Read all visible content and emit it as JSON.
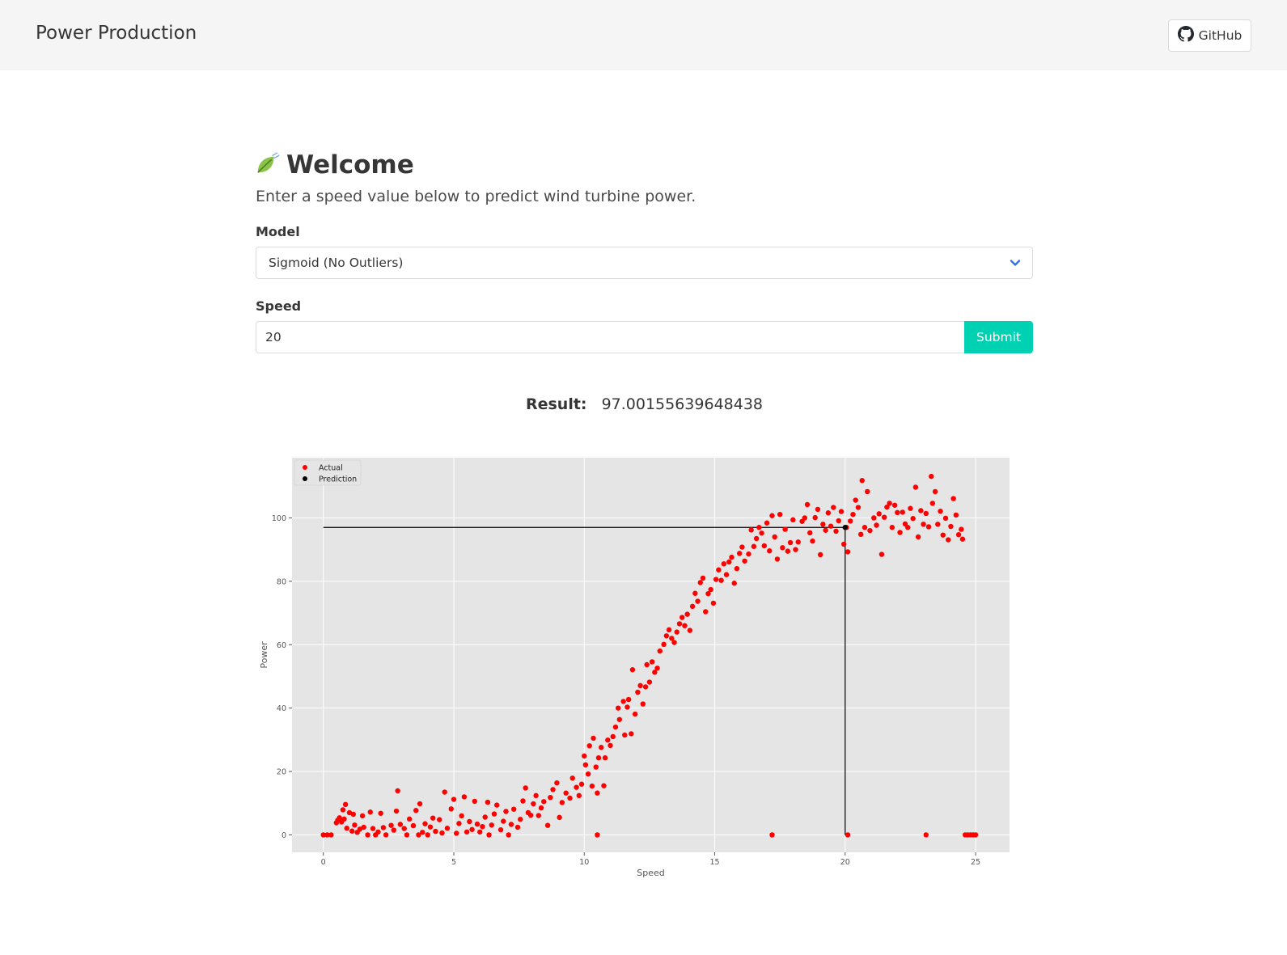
{
  "navbar": {
    "brand": "Power Production",
    "github_label": "GitHub"
  },
  "hero": {
    "title": "Welcome",
    "subtitle": "Enter a speed value below to predict wind turbine power."
  },
  "form": {
    "model_label": "Model",
    "model_value": "Sigmoid (No Outliers)",
    "speed_label": "Speed",
    "speed_value": "20",
    "submit_label": "Submit"
  },
  "result": {
    "label": "Result:",
    "value": "97.00155639648438"
  },
  "colors": {
    "accent": "#00d1b2",
    "actual": "#ff0000",
    "prediction": "#000000",
    "chevron": "#3273dc"
  },
  "chart_data": {
    "type": "scatter",
    "title": "",
    "xlabel": "Speed",
    "ylabel": "Power",
    "xlim": [
      -1.2,
      26.3
    ],
    "ylim": [
      -5.5,
      119
    ],
    "xticks": [
      0,
      5,
      10,
      15,
      20,
      25
    ],
    "yticks": [
      0,
      20,
      40,
      60,
      80,
      100
    ],
    "grid": true,
    "legend": "top-left",
    "series": [
      {
        "name": "Actual",
        "color": "#ff0000",
        "points": [
          [
            0,
            0
          ],
          [
            0.15,
            0
          ],
          [
            0.3,
            0
          ],
          [
            0.5,
            3.8
          ],
          [
            0.55,
            4.6
          ],
          [
            0.62,
            5.4
          ],
          [
            0.7,
            4.1
          ],
          [
            0.75,
            7.9
          ],
          [
            0.8,
            5.0
          ],
          [
            0.85,
            9.6
          ],
          [
            0.9,
            2.1
          ],
          [
            1.0,
            7.0
          ],
          [
            1.1,
            1.2
          ],
          [
            1.15,
            6.5
          ],
          [
            1.2,
            3.1
          ],
          [
            1.3,
            0.8
          ],
          [
            1.4,
            1.8
          ],
          [
            1.5,
            6.0
          ],
          [
            1.55,
            2.4
          ],
          [
            1.7,
            0
          ],
          [
            1.8,
            7.2
          ],
          [
            1.9,
            2.0
          ],
          [
            2.0,
            0
          ],
          [
            2.1,
            0.9
          ],
          [
            2.2,
            6.8
          ],
          [
            2.3,
            2.3
          ],
          [
            2.4,
            0
          ],
          [
            2.6,
            3.0
          ],
          [
            2.7,
            1.5
          ],
          [
            2.8,
            7.5
          ],
          [
            2.85,
            13.9
          ],
          [
            2.95,
            3.3
          ],
          [
            3.1,
            2.0
          ],
          [
            3.2,
            0
          ],
          [
            3.3,
            5.0
          ],
          [
            3.45,
            2.9
          ],
          [
            3.55,
            7.7
          ],
          [
            3.65,
            0
          ],
          [
            3.7,
            9.8
          ],
          [
            3.8,
            0.8
          ],
          [
            3.9,
            3.5
          ],
          [
            4.0,
            0
          ],
          [
            4.1,
            2.5
          ],
          [
            4.2,
            5.3
          ],
          [
            4.3,
            1.1
          ],
          [
            4.45,
            4.8
          ],
          [
            4.55,
            0.6
          ],
          [
            4.65,
            13.5
          ],
          [
            4.75,
            2.1
          ],
          [
            4.9,
            8.2
          ],
          [
            5.0,
            11.2
          ],
          [
            5.1,
            0.5
          ],
          [
            5.2,
            3.6
          ],
          [
            5.3,
            6.0
          ],
          [
            5.4,
            12.0
          ],
          [
            5.5,
            0.9
          ],
          [
            5.6,
            4.2
          ],
          [
            5.7,
            1.7
          ],
          [
            5.8,
            10.6
          ],
          [
            5.9,
            3.4
          ],
          [
            6.0,
            0.9
          ],
          [
            6.1,
            2.6
          ],
          [
            6.2,
            5.6
          ],
          [
            6.3,
            10.3
          ],
          [
            6.35,
            0
          ],
          [
            6.45,
            3.1
          ],
          [
            6.55,
            6.6
          ],
          [
            6.65,
            9.4
          ],
          [
            6.8,
            1.6
          ],
          [
            6.9,
            4.3
          ],
          [
            7.0,
            7.4
          ],
          [
            7.1,
            0
          ],
          [
            7.2,
            3.3
          ],
          [
            7.3,
            8.1
          ],
          [
            7.45,
            2.4
          ],
          [
            7.55,
            4.9
          ],
          [
            7.65,
            10.7
          ],
          [
            7.75,
            14.8
          ],
          [
            7.85,
            7.0
          ],
          [
            7.95,
            6.2
          ],
          [
            8.05,
            9.8
          ],
          [
            8.15,
            12.4
          ],
          [
            8.25,
            6.1
          ],
          [
            8.35,
            8.5
          ],
          [
            8.45,
            10.5
          ],
          [
            8.6,
            3.0
          ],
          [
            8.7,
            11.8
          ],
          [
            8.8,
            14.3
          ],
          [
            8.95,
            16.4
          ],
          [
            9.05,
            5.5
          ],
          [
            9.15,
            10.2
          ],
          [
            9.3,
            13.2
          ],
          [
            9.45,
            11.6
          ],
          [
            9.55,
            17.9
          ],
          [
            9.7,
            15.0
          ],
          [
            9.8,
            12.4
          ],
          [
            9.9,
            16.0
          ],
          [
            10.0,
            24.9
          ],
          [
            10.05,
            22.1
          ],
          [
            10.15,
            19.2
          ],
          [
            10.2,
            28.1
          ],
          [
            10.3,
            15.4
          ],
          [
            10.35,
            30.5
          ],
          [
            10.45,
            21.4
          ],
          [
            10.5,
            13.2
          ],
          [
            10.55,
            24.3
          ],
          [
            10.5,
            0
          ],
          [
            10.65,
            27.6
          ],
          [
            10.75,
            15.5
          ],
          [
            10.8,
            24.3
          ],
          [
            10.9,
            29.9
          ],
          [
            11.0,
            28.2
          ],
          [
            11.1,
            31.0
          ],
          [
            11.2,
            34.0
          ],
          [
            11.3,
            40.0
          ],
          [
            11.35,
            36.4
          ],
          [
            11.5,
            42.1
          ],
          [
            11.55,
            31.5
          ],
          [
            11.65,
            40.3
          ],
          [
            11.7,
            42.7
          ],
          [
            11.8,
            31.9
          ],
          [
            11.85,
            52.1
          ],
          [
            11.95,
            38.1
          ],
          [
            12.05,
            45.0
          ],
          [
            12.15,
            47.1
          ],
          [
            12.25,
            41.3
          ],
          [
            12.35,
            46.7
          ],
          [
            12.4,
            53.7
          ],
          [
            12.5,
            48.2
          ],
          [
            12.6,
            54.6
          ],
          [
            12.7,
            51.3
          ],
          [
            12.8,
            52.6
          ],
          [
            12.9,
            58.0
          ],
          [
            13.05,
            60.1
          ],
          [
            13.15,
            62.8
          ],
          [
            13.25,
            64.7
          ],
          [
            13.35,
            62.0
          ],
          [
            13.45,
            60.7
          ],
          [
            13.55,
            64.0
          ],
          [
            13.65,
            66.6
          ],
          [
            13.75,
            68.6
          ],
          [
            13.85,
            66.0
          ],
          [
            13.95,
            69.6
          ],
          [
            14.05,
            64.5
          ],
          [
            14.15,
            72.1
          ],
          [
            14.25,
            76.2
          ],
          [
            14.35,
            73.7
          ],
          [
            14.45,
            79.6
          ],
          [
            14.55,
            81.0
          ],
          [
            14.65,
            70.4
          ],
          [
            14.75,
            76.1
          ],
          [
            14.85,
            77.4
          ],
          [
            14.95,
            73.1
          ],
          [
            15.05,
            80.6
          ],
          [
            15.15,
            83.6
          ],
          [
            15.25,
            80.3
          ],
          [
            15.35,
            85.5
          ],
          [
            15.45,
            82.1
          ],
          [
            15.55,
            86.1
          ],
          [
            15.65,
            87.6
          ],
          [
            15.75,
            79.4
          ],
          [
            15.85,
            84.0
          ],
          [
            15.95,
            88.8
          ],
          [
            16.05,
            90.8
          ],
          [
            16.15,
            86.4
          ],
          [
            16.3,
            88.6
          ],
          [
            16.4,
            96.2
          ],
          [
            16.5,
            91.0
          ],
          [
            16.6,
            93.5
          ],
          [
            16.7,
            97.0
          ],
          [
            16.8,
            95.2
          ],
          [
            16.9,
            91.2
          ],
          [
            17.0,
            98.4
          ],
          [
            17.1,
            89.6
          ],
          [
            17.2,
            100.7
          ],
          [
            17.3,
            94.0
          ],
          [
            17.4,
            87.0
          ],
          [
            17.5,
            101.1
          ],
          [
            17.6,
            90.6
          ],
          [
            17.7,
            96.4
          ],
          [
            17.8,
            89.5
          ],
          [
            17.9,
            92.2
          ],
          [
            18.0,
            99.4
          ],
          [
            18.1,
            90.0
          ],
          [
            18.2,
            92.4
          ],
          [
            18.35,
            98.9
          ],
          [
            18.45,
            100.0
          ],
          [
            18.55,
            104.2
          ],
          [
            18.65,
            95.3
          ],
          [
            18.75,
            92.7
          ],
          [
            18.85,
            100.1
          ],
          [
            18.95,
            102.7
          ],
          [
            19.05,
            88.4
          ],
          [
            19.15,
            98.0
          ],
          [
            19.25,
            96.1
          ],
          [
            19.35,
            101.6
          ],
          [
            19.45,
            97.4
          ],
          [
            19.55,
            103.3
          ],
          [
            19.65,
            95.8
          ],
          [
            19.75,
            99.1
          ],
          [
            19.85,
            102.0
          ],
          [
            19.95,
            91.7
          ],
          [
            20.05,
            97.0
          ],
          [
            20.1,
            89.3
          ],
          [
            20.2,
            99.0
          ],
          [
            20.3,
            101.1
          ],
          [
            20.4,
            105.6
          ],
          [
            20.5,
            103.3
          ],
          [
            20.6,
            94.8
          ],
          [
            20.65,
            111.8
          ],
          [
            20.75,
            97.0
          ],
          [
            20.85,
            108.3
          ],
          [
            20.95,
            96.0
          ],
          [
            21.1,
            100.0
          ],
          [
            21.2,
            97.7
          ],
          [
            21.3,
            101.3
          ],
          [
            21.4,
            88.5
          ],
          [
            21.5,
            100.2
          ],
          [
            21.6,
            103.4
          ],
          [
            21.7,
            104.6
          ],
          [
            21.8,
            97.0
          ],
          [
            21.9,
            104.0
          ],
          [
            22.0,
            101.7
          ],
          [
            22.1,
            95.4
          ],
          [
            22.2,
            101.8
          ],
          [
            22.3,
            98.1
          ],
          [
            22.4,
            97.0
          ],
          [
            22.5,
            103.0
          ],
          [
            22.6,
            99.8
          ],
          [
            22.7,
            109.7
          ],
          [
            22.8,
            94.0
          ],
          [
            22.9,
            102.3
          ],
          [
            23.0,
            98.0
          ],
          [
            23.1,
            101.4
          ],
          [
            23.2,
            97.2
          ],
          [
            23.3,
            113.1
          ],
          [
            23.35,
            104.6
          ],
          [
            23.45,
            108.3
          ],
          [
            23.55,
            98.0
          ],
          [
            23.65,
            102.1
          ],
          [
            23.75,
            94.6
          ],
          [
            23.85,
            99.9
          ],
          [
            23.95,
            93.1
          ],
          [
            24.05,
            97.3
          ],
          [
            24.15,
            106.1
          ],
          [
            24.25,
            100.9
          ],
          [
            24.35,
            94.7
          ],
          [
            24.45,
            96.4
          ],
          [
            24.5,
            93.3
          ],
          [
            17.2,
            0
          ],
          [
            20.1,
            0
          ],
          [
            23.1,
            0
          ],
          [
            24.6,
            0
          ],
          [
            24.7,
            0
          ],
          [
            24.8,
            0
          ],
          [
            24.9,
            0
          ],
          [
            25.0,
            0
          ]
        ]
      },
      {
        "name": "Prediction",
        "color": "#000000",
        "points": [
          [
            20,
            97.00155639648438
          ]
        ]
      }
    ]
  }
}
